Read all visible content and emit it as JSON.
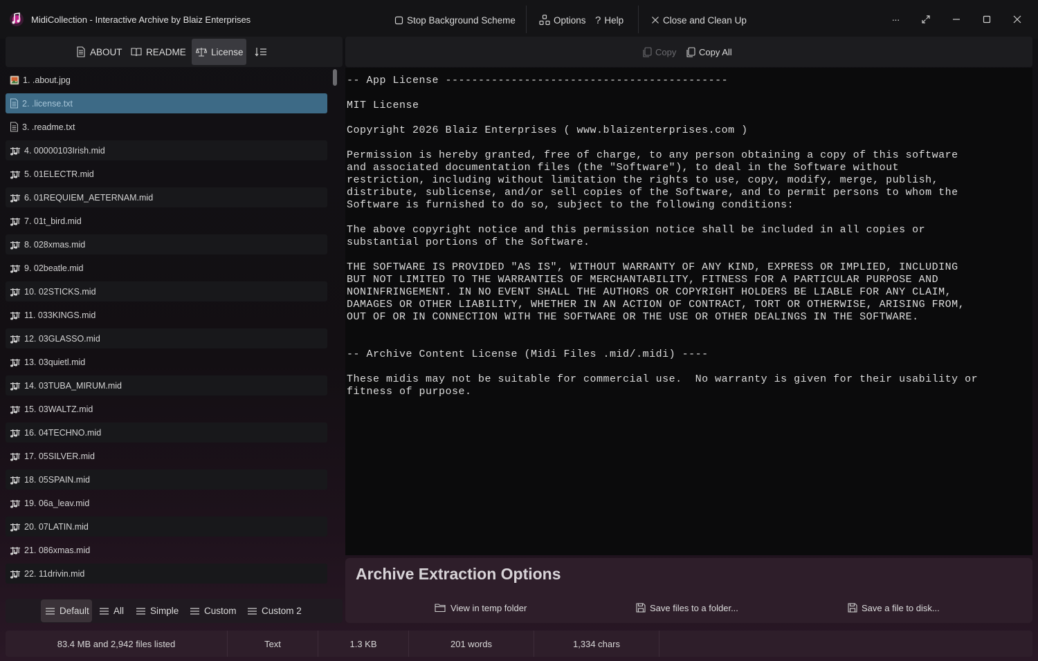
{
  "window": {
    "app_name": "MidiCollection",
    "title_suffix": " -  Interactive Archive by Blaiz Enterprises"
  },
  "titlebar": {
    "stop_background": "Stop Background Scheme",
    "options": "Options",
    "help": "Help",
    "close_cleanup": "Close and Clean Up",
    "more": "···"
  },
  "left_toolbar": {
    "about": "ABOUT",
    "readme": "README",
    "license": "License"
  },
  "files": [
    {
      "label": "1. .about.jpg",
      "kind": "image"
    },
    {
      "label": "2. .license.txt",
      "kind": "text"
    },
    {
      "label": "3. .readme.txt",
      "kind": "text"
    },
    {
      "label": "4. 00000103Irish.mid",
      "kind": "midi"
    },
    {
      "label": "5. 01ELECTR.mid",
      "kind": "midi"
    },
    {
      "label": "6. 01REQUIEM_AETERNAM.mid",
      "kind": "midi"
    },
    {
      "label": "7. 01t_bird.mid",
      "kind": "midi"
    },
    {
      "label": "8. 028xmas.mid",
      "kind": "midi"
    },
    {
      "label": "9. 02beatle.mid",
      "kind": "midi"
    },
    {
      "label": "10. 02STICKS.mid",
      "kind": "midi"
    },
    {
      "label": "11. 033KINGS.mid",
      "kind": "midi"
    },
    {
      "label": "12. 03GLASSO.mid",
      "kind": "midi"
    },
    {
      "label": "13. 03quietl.mid",
      "kind": "midi"
    },
    {
      "label": "14. 03TUBA_MIRUM.mid",
      "kind": "midi"
    },
    {
      "label": "15. 03WALTZ.mid",
      "kind": "midi"
    },
    {
      "label": "16. 04TECHNO.mid",
      "kind": "midi"
    },
    {
      "label": "17. 05SILVER.mid",
      "kind": "midi"
    },
    {
      "label": "18. 05SPAIN.mid",
      "kind": "midi"
    },
    {
      "label": "19. 06a_leav.mid",
      "kind": "midi"
    },
    {
      "label": "20. 07LATIN.mid",
      "kind": "midi"
    },
    {
      "label": "21. 086xmas.mid",
      "kind": "midi"
    },
    {
      "label": "22. 11drivin.mid",
      "kind": "midi"
    }
  ],
  "left_bottom": {
    "default": "Default",
    "all": "All",
    "simple": "Simple",
    "custom": "Custom",
    "custom2": "Custom 2"
  },
  "right_toolbar": {
    "copy": "Copy",
    "copy_all": "Copy All"
  },
  "license_text": "-- App License -------------------------------------------\n\nMIT License\n\nCopyright 2026 Blaiz Enterprises ( www.blaizenterprises.com )\n\nPermission is hereby granted, free of charge, to any person obtaining a copy of this software\nand associated documentation files (the \"Software\"), to deal in the Software without\nrestriction, including without limitation the rights to use, copy, modify, merge, publish,\ndistribute, sublicense, and/or sell copies of the Software, and to permit persons to whom the\nSoftware is furnished to do so, subject to the following conditions:\n\nThe above copyright notice and this permission notice shall be included in all copies or\nsubstantial portions of the Software.\n\nTHE SOFTWARE IS PROVIDED \"AS IS\", WITHOUT WARRANTY OF ANY KIND, EXPRESS OR IMPLIED, INCLUDING\nBUT NOT LIMITED TO THE WARRANTIES OF MERCHANTABILITY, FITNESS FOR A PARTICULAR PURPOSE AND\nNONINFRINGEMENT. IN NO EVENT SHALL THE AUTHORS OR COPYRIGHT HOLDERS BE LIABLE FOR ANY CLAIM,\nDAMAGES OR OTHER LIABILITY, WHETHER IN AN ACTION OF CONTRACT, TORT OR OTHERWISE, ARISING FROM,\nOUT OF OR IN CONNECTION WITH THE SOFTWARE OR THE USE OR OTHER DEALINGS IN THE SOFTWARE.\n\n\n-- Archive Content License (Midi Files .mid/.midi) ----\n\nThese midis may not be suitable for commercial use.  No warranty is given for their usability or\nfitness of purpose.",
  "extraction": {
    "title": "Archive Extraction Options",
    "view_temp": "View in temp folder",
    "save_folder": "Save files to a folder...",
    "save_disk": "Save a file to disk..."
  },
  "status": {
    "summary": "83.4 MB and 2,942 files listed",
    "type": "Text",
    "size": "1.3 KB",
    "words": "201 words",
    "chars": "1,334 chars"
  },
  "colors": {
    "selected_row": "#3d6a86",
    "panel_accent": "#2e1e2a",
    "background": "#111114"
  },
  "icons": {
    "image_file": "image-file-icon",
    "text_file": "text-file-icon",
    "midi_file": "music-notes-icon"
  }
}
